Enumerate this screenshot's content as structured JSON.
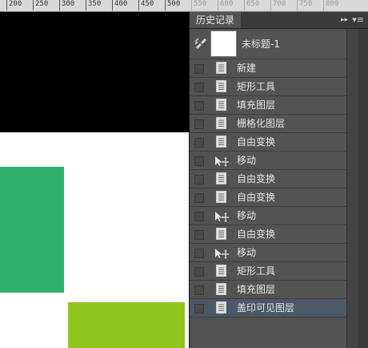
{
  "ruler": {
    "ticks": [
      {
        "label": "200",
        "dim": false
      },
      {
        "label": "250",
        "dim": false
      },
      {
        "label": "300",
        "dim": false
      },
      {
        "label": "350",
        "dim": false
      },
      {
        "label": "400",
        "dim": false
      },
      {
        "label": "450",
        "dim": false
      },
      {
        "label": "500",
        "dim": false
      },
      {
        "label": "550",
        "dim": true
      },
      {
        "label": "600",
        "dim": true
      },
      {
        "label": "650",
        "dim": true
      },
      {
        "label": "700",
        "dim": true
      },
      {
        "label": "750",
        "dim": true
      },
      {
        "label": "800",
        "dim": true
      }
    ]
  },
  "canvas": {
    "colors": {
      "black": "#000000",
      "white": "#ffffff",
      "green": "#2eb06d",
      "lime": "#90c420"
    }
  },
  "history_panel": {
    "tab_title": "历史记录",
    "collapse_glyph": "▸▸",
    "menu_glyph": "▾≡",
    "snapshot": {
      "label": "未标题-1",
      "icon": "history-brush-icon"
    },
    "items": [
      {
        "label": "新建",
        "icon": "document-icon",
        "selected": false
      },
      {
        "label": "矩形工具",
        "icon": "document-icon",
        "selected": false
      },
      {
        "label": "填充图层",
        "icon": "document-icon",
        "selected": false
      },
      {
        "label": "栅格化图层",
        "icon": "document-icon",
        "selected": false
      },
      {
        "label": "自由变换",
        "icon": "document-icon",
        "selected": false
      },
      {
        "label": "移动",
        "icon": "move-tool-icon",
        "selected": false
      },
      {
        "label": "自由变换",
        "icon": "document-icon",
        "selected": false
      },
      {
        "label": "自由变换",
        "icon": "document-icon",
        "selected": false
      },
      {
        "label": "移动",
        "icon": "move-tool-icon",
        "selected": false
      },
      {
        "label": "自由变换",
        "icon": "document-icon",
        "selected": false
      },
      {
        "label": "移动",
        "icon": "move-tool-icon",
        "selected": false
      },
      {
        "label": "矩形工具",
        "icon": "document-icon",
        "selected": false
      },
      {
        "label": "填充图层",
        "icon": "document-icon",
        "selected": false
      },
      {
        "label": "盖印可见图层",
        "icon": "document-icon",
        "selected": true
      }
    ]
  }
}
